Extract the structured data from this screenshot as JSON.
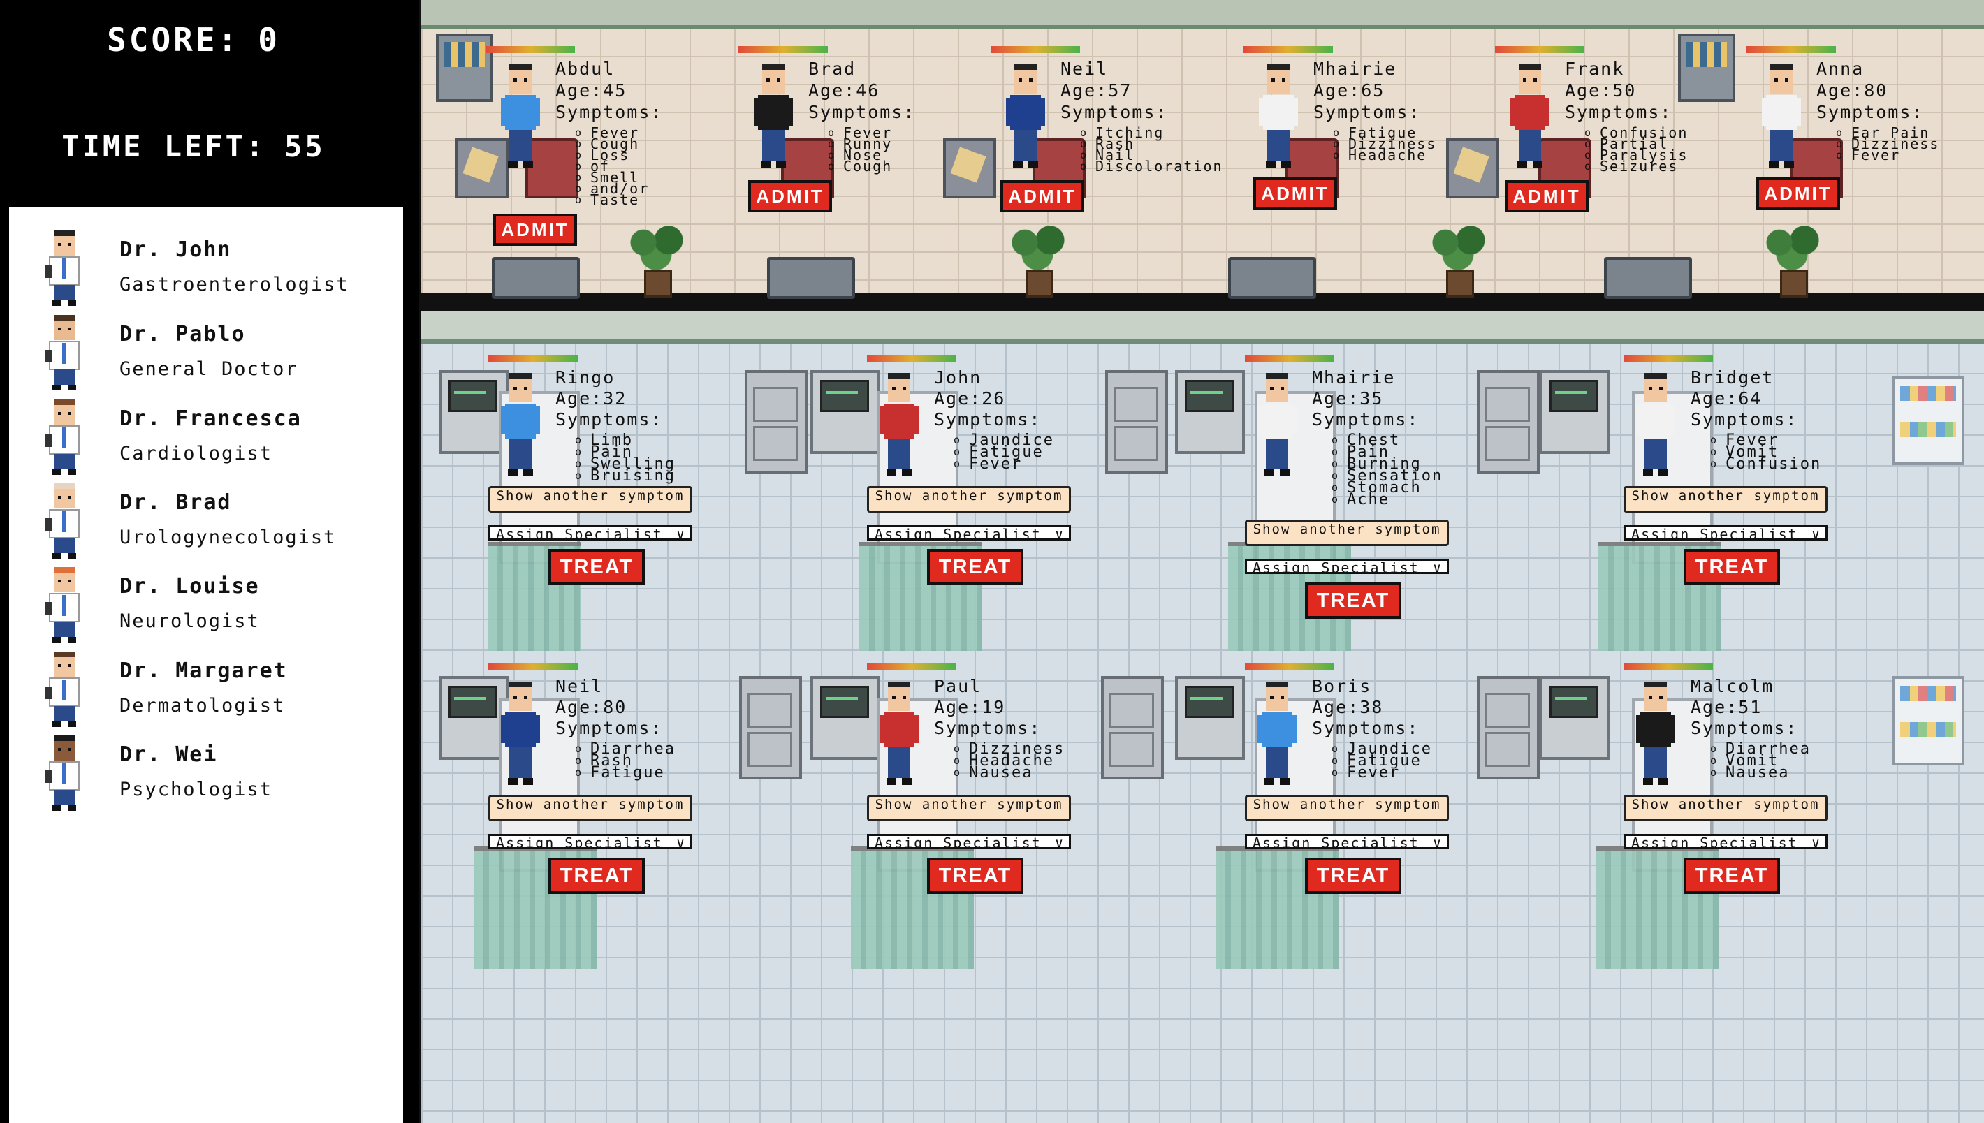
{
  "hud": {
    "score_label": "SCORE:",
    "score_value": "0",
    "time_label": "TIME LEFT:",
    "time_value": "55"
  },
  "doctors": [
    {
      "name": "Dr. John",
      "specialty": "Gastroenterologist",
      "hair": "#222222",
      "skin": "#f1c7a1"
    },
    {
      "name": "Dr. Pablo",
      "specialty": "General Doctor",
      "hair": "#4a3222",
      "skin": "#e9b98f"
    },
    {
      "name": "Dr. Francesca",
      "specialty": "Cardiologist",
      "hair": "#7a4a2a",
      "skin": "#f1c7a1"
    },
    {
      "name": "Dr. Brad",
      "specialty": "Urologynecologist",
      "hair": "#e8d4c0",
      "skin": "#f1c7a1"
    },
    {
      "name": "Dr. Louise",
      "specialty": "Neurologist",
      "hair": "#e0703a",
      "skin": "#f1c7a1"
    },
    {
      "name": "Dr. Margaret",
      "specialty": "Dermatologist",
      "hair": "#5a3a22",
      "skin": "#f1c7a1"
    },
    {
      "name": "Dr. Wei",
      "specialty": "Psychologist",
      "hair": "#1a1a1a",
      "skin": "#8a5a3a"
    }
  ],
  "waiting": [
    {
      "name": "Abdul",
      "age": "Age:45",
      "symptoms_label": "Symptoms:",
      "symptoms": [
        "Fever",
        "Cough",
        "Loss",
        "of",
        "Smell",
        "and/or",
        "Taste"
      ],
      "admit": "ADMIT",
      "shirt": "#3d8fe0"
    },
    {
      "name": "Brad",
      "age": "Age:46",
      "symptoms_label": "Symptoms:",
      "symptoms": [
        "Fever",
        "Runny",
        "Nose",
        "Cough"
      ],
      "admit": "ADMIT",
      "shirt": "#1a1a1a"
    },
    {
      "name": "Neil",
      "age": "Age:57",
      "symptoms_label": "Symptoms:",
      "symptoms": [
        "Itching",
        "Rash",
        "Nail",
        "Discoloration"
      ],
      "admit": "ADMIT",
      "shirt": "#1f3f8f"
    },
    {
      "name": "Mhairie",
      "age": "Age:65",
      "symptoms_label": "Symptoms:",
      "symptoms": [
        "Fatigue",
        "Dizziness",
        "Headache"
      ],
      "admit": "ADMIT",
      "shirt": "#f2f2f2"
    },
    {
      "name": "Frank",
      "age": "Age:50",
      "symptoms_label": "Symptoms:",
      "symptoms": [
        "Confusion",
        "Partial",
        "Paralysis",
        "Seizures"
      ],
      "admit": "ADMIT",
      "shirt": "#c8302f"
    },
    {
      "name": "Anna",
      "age": "Age:80",
      "symptoms_label": "Symptoms:",
      "symptoms": [
        "Ear Pain",
        "Dizziness",
        "Fever"
      ],
      "admit": "ADMIT",
      "shirt": "#f2f2f2"
    }
  ],
  "beds": [
    {
      "name": "Ringo",
      "age": "Age:32",
      "symptoms_label": "Symptoms:",
      "symptoms": [
        "Limb",
        "Pain",
        "Swelling",
        "Bruising"
      ],
      "show": "Show another symptom",
      "assign": "Assign Specialist",
      "treat": "TREAT",
      "shirt": "#3d8fe0"
    },
    {
      "name": "John",
      "age": "Age:26",
      "symptoms_label": "Symptoms:",
      "symptoms": [
        "Jaundice",
        "Fatigue",
        "Fever"
      ],
      "show": "Show another symptom",
      "assign": "Assign Specialist",
      "treat": "TREAT",
      "shirt": "#c8302f"
    },
    {
      "name": "Mhairie",
      "age": "Age:35",
      "symptoms_label": "Symptoms:",
      "symptoms": [
        "Chest",
        "Pain",
        "Burning",
        "Sensation",
        "Stomach",
        "Ache"
      ],
      "show": "Show another symptom",
      "assign": "Assign Specialist",
      "treat": "TREAT",
      "shirt": "#f2f2f2"
    },
    {
      "name": "Bridget",
      "age": "Age:64",
      "symptoms_label": "Symptoms:",
      "symptoms": [
        "Fever",
        "Vomit",
        "Confusion"
      ],
      "show": "Show another symptom",
      "assign": "Assign Specialist",
      "treat": "TREAT",
      "shirt": "#f2f2f2"
    },
    {
      "name": "Neil",
      "age": "Age:80",
      "symptoms_label": "Symptoms:",
      "symptoms": [
        "Diarrhea",
        "Rash",
        "Fatigue"
      ],
      "show": "Show another symptom",
      "assign": "Assign Specialist",
      "treat": "TREAT",
      "shirt": "#1f3f8f"
    },
    {
      "name": "Paul",
      "age": "Age:19",
      "symptoms_label": "Symptoms:",
      "symptoms": [
        "Dizziness",
        "Headache",
        "Nausea"
      ],
      "show": "Show another symptom",
      "assign": "Assign Specialist",
      "treat": "TREAT",
      "shirt": "#c8302f"
    },
    {
      "name": "Boris",
      "age": "Age:38",
      "symptoms_label": "Symptoms:",
      "symptoms": [
        "Jaundice",
        "Fatigue",
        "Fever"
      ],
      "show": "Show another symptom",
      "assign": "Assign Specialist",
      "treat": "TREAT",
      "shirt": "#3d8fe0"
    },
    {
      "name": "Malcolm",
      "age": "Age:51",
      "symptoms_label": "Symptoms:",
      "symptoms": [
        "Diarrhea",
        "Vomit",
        "Nausea"
      ],
      "show": "Show another symptom",
      "assign": "Assign Specialist",
      "treat": "TREAT",
      "shirt": "#1a1a1a"
    }
  ]
}
